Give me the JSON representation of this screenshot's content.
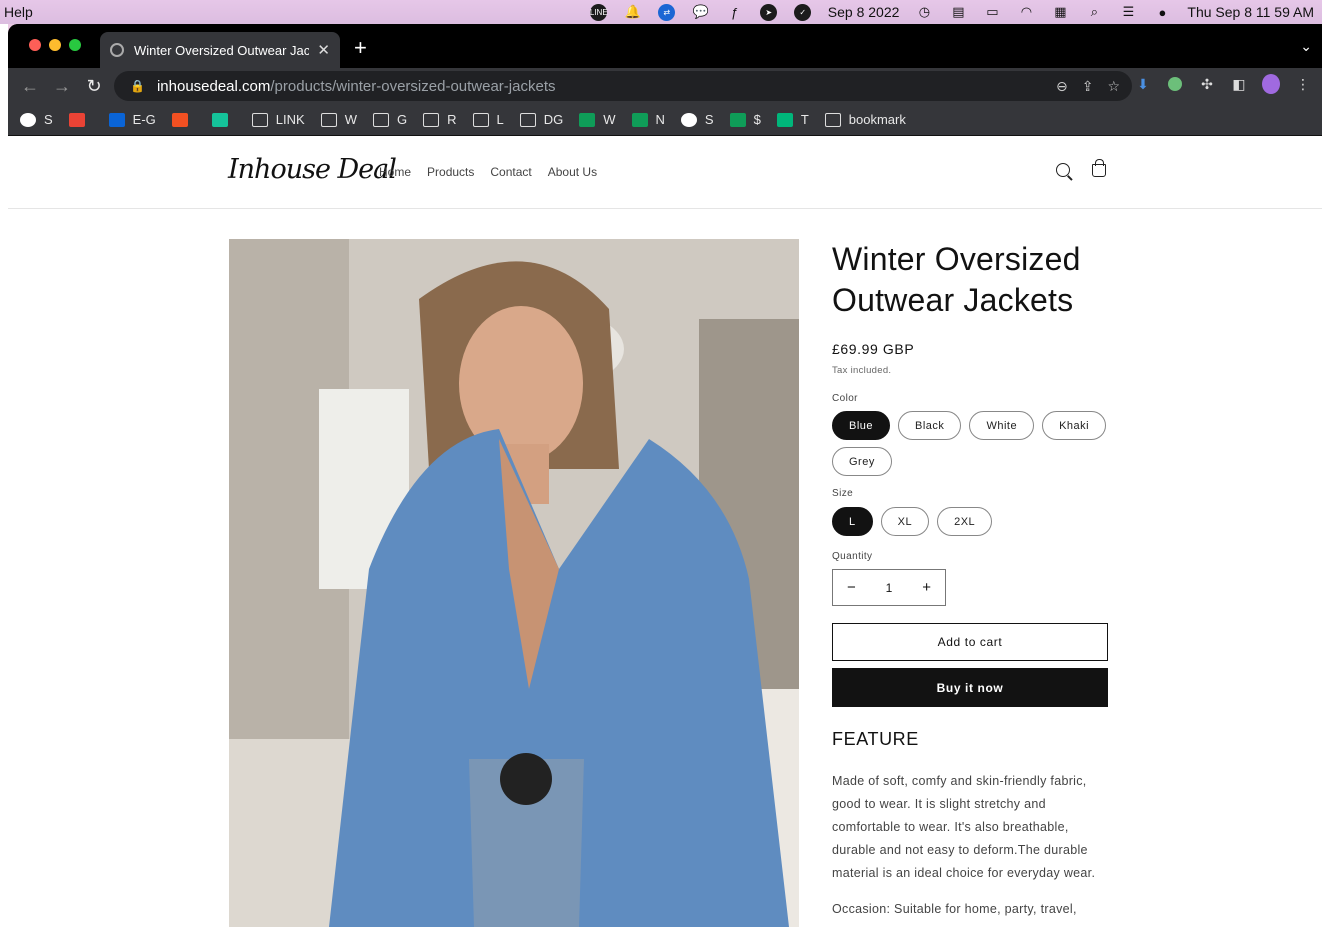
{
  "menubar": {
    "app_menu": "Help",
    "date_widget": "Sep 8 2022",
    "clock": "Thu Sep 8  11 59 AM"
  },
  "browser": {
    "tab_title": "Winter Oversized Outwear Jackets",
    "url_host": "inhousedeal.com",
    "url_path": "/products/winter-oversized-outwear-jackets",
    "bookmarks": [
      {
        "label": "S",
        "icon": "globe-icon"
      },
      {
        "label": "",
        "icon": "gmail-icon"
      },
      {
        "label": "E-G",
        "icon": "outlook-icon"
      },
      {
        "label": "",
        "icon": "microsoft-icon"
      },
      {
        "label": "",
        "icon": "grammarly-icon"
      },
      {
        "label": "LINK",
        "icon": "folder-icon"
      },
      {
        "label": "W",
        "icon": "folder-icon"
      },
      {
        "label": "G",
        "icon": "folder-icon"
      },
      {
        "label": "R",
        "icon": "folder-icon"
      },
      {
        "label": "L",
        "icon": "folder-icon"
      },
      {
        "label": "DG",
        "icon": "folder-icon"
      },
      {
        "label": "W",
        "icon": "sheets-icon"
      },
      {
        "label": "N",
        "icon": "sheets-icon"
      },
      {
        "label": "S",
        "icon": "globe-icon"
      },
      {
        "label": "$",
        "icon": "sheets-icon"
      },
      {
        "label": "T",
        "icon": "star-icon"
      },
      {
        "label": "bookmark",
        "icon": "folder-icon"
      }
    ]
  },
  "site": {
    "logo": "Inhouse Deal",
    "nav": [
      "Home",
      "Products",
      "Contact",
      "About Us"
    ]
  },
  "product": {
    "title": "Winter Oversized Outwear Jackets",
    "price": "£69.99 GBP",
    "tax_note": "Tax included.",
    "color_label": "Color",
    "colors": [
      "Blue",
      "Black",
      "White",
      "Khaki",
      "Grey"
    ],
    "selected_color": "Blue",
    "size_label": "Size",
    "sizes": [
      "L",
      "XL",
      "2XL"
    ],
    "selected_size": "L",
    "quantity_label": "Quantity",
    "quantity": "1",
    "decrease": "−",
    "increase": "+",
    "add_to_cart": "Add to cart",
    "buy_now": "Buy it now",
    "feature_heading": "FEATURE",
    "description": "Made of soft, comfy and skin-friendly fabric, good to wear. It is slight stretchy and comfortable to wear. It's also breathable, durable and not easy to deform.The durable material is an ideal choice for everyday wear.",
    "occasion": "Occasion: Suitable for home, party, travel,"
  },
  "colors": {
    "accent": "#121212",
    "jacket_blue": "#5f8cc0",
    "menubar_bg": "#e6c7e8"
  }
}
